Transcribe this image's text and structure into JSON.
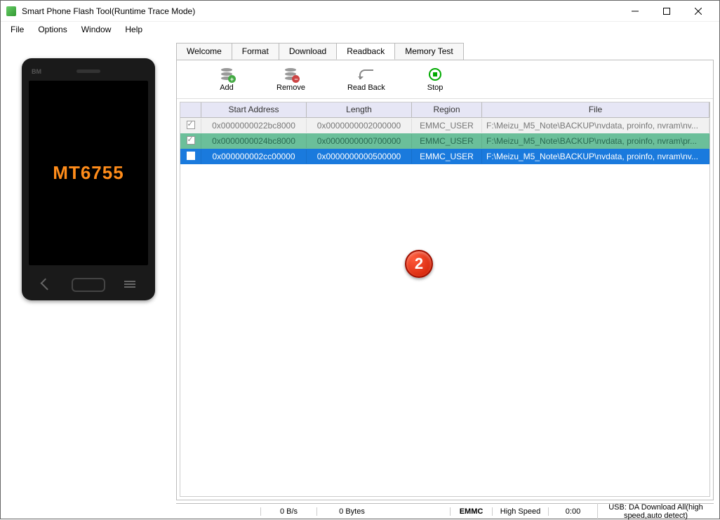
{
  "window": {
    "title": "Smart Phone Flash Tool(Runtime Trace Mode)"
  },
  "menu": {
    "file": "File",
    "options": "Options",
    "window": "Window",
    "help": "Help"
  },
  "phone": {
    "brand": "BM",
    "chip": "MT6755"
  },
  "tabs": {
    "welcome": "Welcome",
    "format": "Format",
    "download": "Download",
    "readback": "Readback",
    "memory": "Memory Test"
  },
  "toolbar": {
    "add": "Add",
    "remove": "Remove",
    "readback": "Read Back",
    "stop": "Stop"
  },
  "table": {
    "headers": {
      "start": "Start Address",
      "length": "Length",
      "region": "Region",
      "file": "File"
    },
    "rows": [
      {
        "start": "0x0000000022bc8000",
        "length": "0x0000000002000000",
        "region": "EMMC_USER",
        "file": "F:\\Meizu_M5_Note\\BACKUP\\nvdata, proinfo, nvram\\nv..."
      },
      {
        "start": "0x0000000024bc8000",
        "length": "0x0000000000700000",
        "region": "EMMC_USER",
        "file": "F:\\Meizu_M5_Note\\BACKUP\\nvdata, proinfo, nvram\\pr..."
      },
      {
        "start": "0x000000002cc00000",
        "length": "0x0000000000500000",
        "region": "EMMC_USER",
        "file": "F:\\Meizu_M5_Note\\BACKUP\\nvdata, proinfo, nvram\\nv..."
      }
    ]
  },
  "callout": "2",
  "status": {
    "rate": "0 B/s",
    "bytes": "0 Bytes",
    "mem": "EMMC",
    "speed": "High Speed",
    "time": "0:00",
    "usb": "USB: DA Download All(high speed,auto detect)"
  }
}
